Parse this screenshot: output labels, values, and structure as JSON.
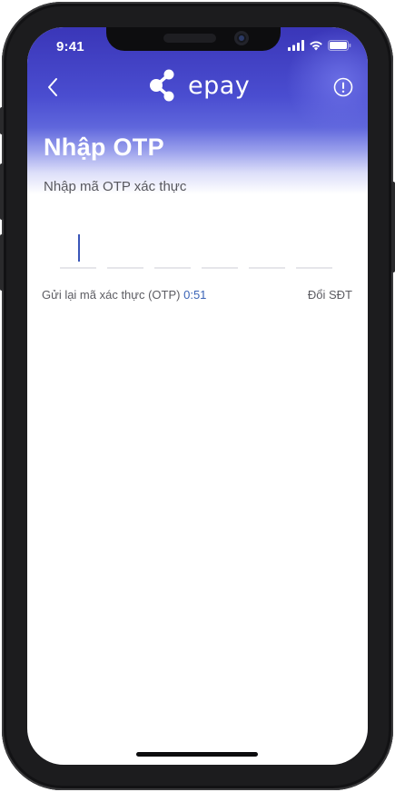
{
  "status_bar": {
    "time": "9:41"
  },
  "header": {
    "logo_text": "epay"
  },
  "page": {
    "title": "Nhập OTP",
    "subtitle": "Nhập mã OTP xác thực"
  },
  "otp": {
    "cells": 6,
    "focused_cell": 1
  },
  "resend": {
    "label": "Gửi lại mã xác thực (OTP)",
    "timer": "0:51",
    "change_phone": "Đổi SĐT"
  },
  "colors": {
    "brand_gradient_top": "#3a36b8",
    "brand_gradient_mid": "#5f66dc",
    "timer": "#3a63b6",
    "caret": "#3a56b8"
  },
  "icons": {
    "back": "chevron-left-icon",
    "info": "info-circle-icon",
    "logo": "epay-logo-icon",
    "signal": "cellular-signal-icon",
    "wifi": "wifi-icon",
    "battery": "battery-icon"
  }
}
